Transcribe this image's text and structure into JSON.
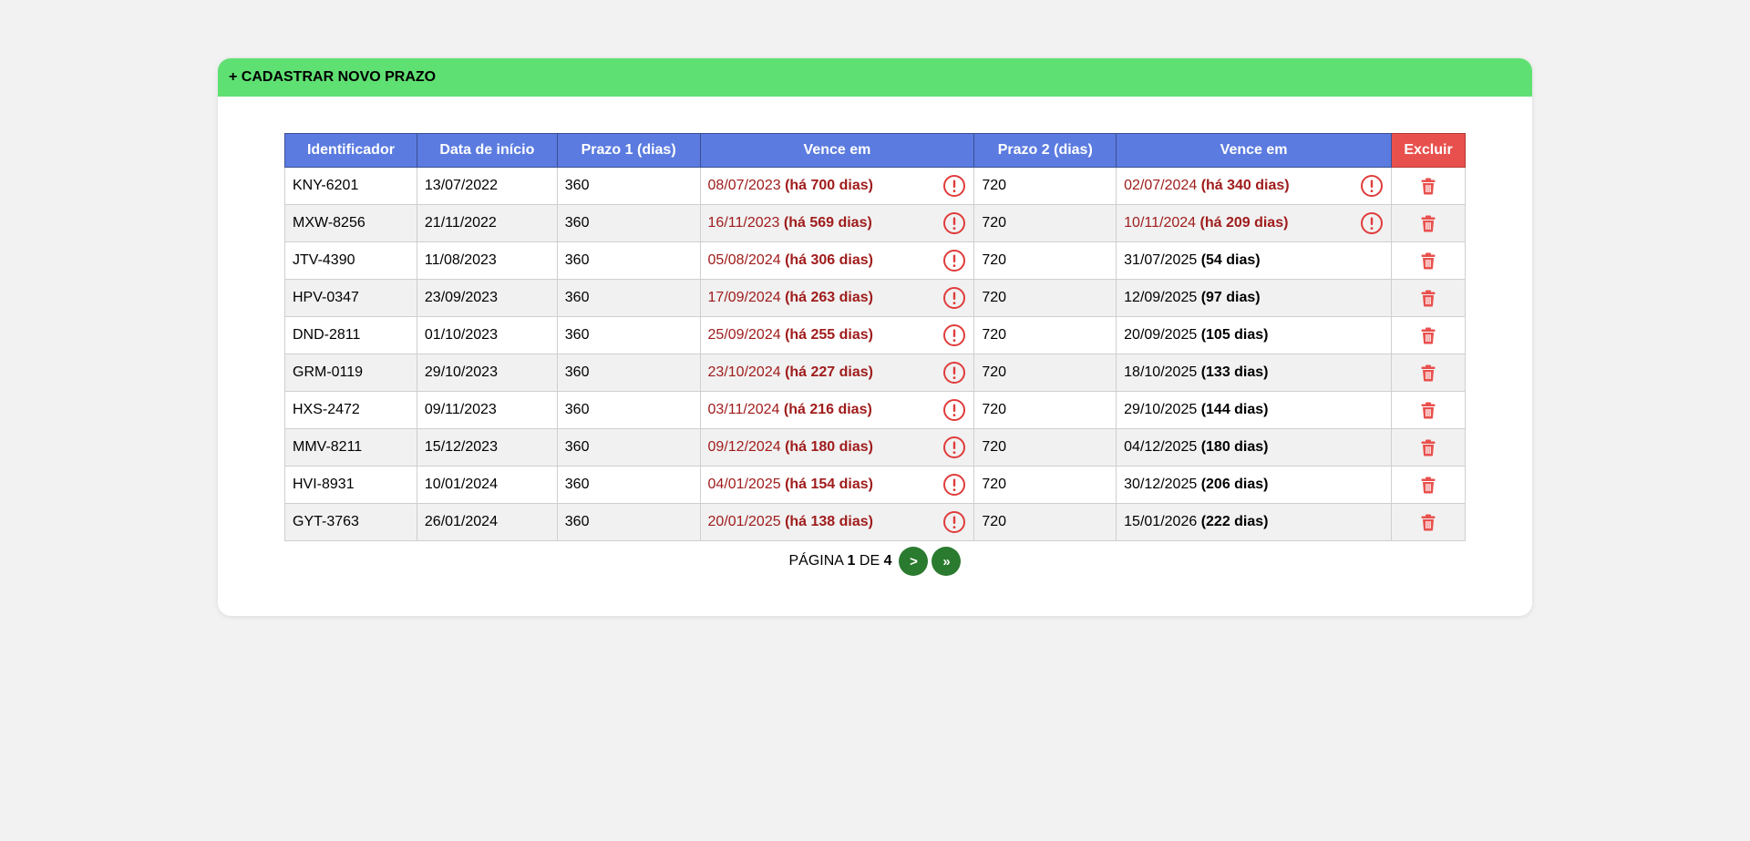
{
  "header": {
    "add_label": "+ CADASTRAR NOVO PRAZO"
  },
  "columns": [
    "Identificador",
    "Data de início",
    "Prazo 1 (dias)",
    "Vence em",
    "Prazo 2 (dias)",
    "Vence em",
    "Excluir"
  ],
  "rows": [
    {
      "id": "KNY-6201",
      "inicio": "13/07/2022",
      "prazo1": "360",
      "vence1_date": "08/07/2023",
      "vence1_days": "(há 700 dias)",
      "vence1_status": "vencido",
      "prazo2": "720",
      "vence2_date": "02/07/2024",
      "vence2_days": "(há 340 dias)",
      "vence2_status": "vencido"
    },
    {
      "id": "MXW-8256",
      "inicio": "21/11/2022",
      "prazo1": "360",
      "vence1_date": "16/11/2023",
      "vence1_days": "(há 569 dias)",
      "vence1_status": "vencido",
      "prazo2": "720",
      "vence2_date": "10/11/2024",
      "vence2_days": "(há 209 dias)",
      "vence2_status": "vencido"
    },
    {
      "id": "JTV-4390",
      "inicio": "11/08/2023",
      "prazo1": "360",
      "vence1_date": "05/08/2024",
      "vence1_days": "(há 306 dias)",
      "vence1_status": "vencido",
      "prazo2": "720",
      "vence2_date": "31/07/2025",
      "vence2_days": "(54 dias)",
      "vence2_status": "ok"
    },
    {
      "id": "HPV-0347",
      "inicio": "23/09/2023",
      "prazo1": "360",
      "vence1_date": "17/09/2024",
      "vence1_days": "(há 263 dias)",
      "vence1_status": "vencido",
      "prazo2": "720",
      "vence2_date": "12/09/2025",
      "vence2_days": "(97 dias)",
      "vence2_status": "ok"
    },
    {
      "id": "DND-2811",
      "inicio": "01/10/2023",
      "prazo1": "360",
      "vence1_date": "25/09/2024",
      "vence1_days": "(há 255 dias)",
      "vence1_status": "vencido",
      "prazo2": "720",
      "vence2_date": "20/09/2025",
      "vence2_days": "(105 dias)",
      "vence2_status": "ok"
    },
    {
      "id": "GRM-0119",
      "inicio": "29/10/2023",
      "prazo1": "360",
      "vence1_date": "23/10/2024",
      "vence1_days": "(há 227 dias)",
      "vence1_status": "vencido",
      "prazo2": "720",
      "vence2_date": "18/10/2025",
      "vence2_days": "(133 dias)",
      "vence2_status": "ok"
    },
    {
      "id": "HXS-2472",
      "inicio": "09/11/2023",
      "prazo1": "360",
      "vence1_date": "03/11/2024",
      "vence1_days": "(há 216 dias)",
      "vence1_status": "vencido",
      "prazo2": "720",
      "vence2_date": "29/10/2025",
      "vence2_days": "(144 dias)",
      "vence2_status": "ok"
    },
    {
      "id": "MMV-8211",
      "inicio": "15/12/2023",
      "prazo1": "360",
      "vence1_date": "09/12/2024",
      "vence1_days": "(há 180 dias)",
      "vence1_status": "vencido",
      "prazo2": "720",
      "vence2_date": "04/12/2025",
      "vence2_days": "(180 dias)",
      "vence2_status": "ok"
    },
    {
      "id": "HVI-8931",
      "inicio": "10/01/2024",
      "prazo1": "360",
      "vence1_date": "04/01/2025",
      "vence1_days": "(há 154 dias)",
      "vence1_status": "vencido",
      "prazo2": "720",
      "vence2_date": "30/12/2025",
      "vence2_days": "(206 dias)",
      "vence2_status": "ok"
    },
    {
      "id": "GYT-3763",
      "inicio": "26/01/2024",
      "prazo1": "360",
      "vence1_date": "20/01/2025",
      "vence1_days": "(há 138 dias)",
      "vence1_status": "vencido",
      "prazo2": "720",
      "vence2_date": "15/01/2026",
      "vence2_days": "(222 dias)",
      "vence2_status": "ok"
    }
  ],
  "icons": {
    "alert": "exclamation-circle-icon",
    "delete": "trash-icon"
  },
  "pagination": {
    "prefix": "PÁGINA",
    "current": "1",
    "separator": "DE",
    "total": "4",
    "next_label": ">",
    "last_label": "»"
  },
  "colors": {
    "header_bar": "#5fe072",
    "table_header": "#5b7be0",
    "delete_header": "#e8504d",
    "overdue_text": "#a01c1c",
    "alert_icon": "#e03b3b",
    "trash_icon": "#e8504d",
    "pager_button": "#2a7a2f"
  }
}
